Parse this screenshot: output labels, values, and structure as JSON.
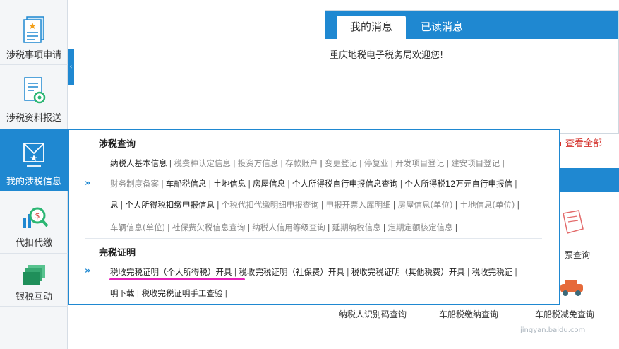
{
  "sidebar": {
    "items": [
      {
        "label": "涉税事项申请",
        "icon": "documents-icon"
      },
      {
        "label": "涉税资料报送",
        "icon": "document-gear-icon"
      },
      {
        "label": "我的涉税信息",
        "icon": "envelope-icon",
        "active": true
      },
      {
        "label": "代扣代缴",
        "icon": "chart-magnifier-icon"
      },
      {
        "label": "银税互动",
        "icon": "stacked-windows-icon"
      }
    ],
    "collapse_glyph": "‹"
  },
  "messages": {
    "tabs": [
      {
        "label": "我的消息",
        "active": true
      },
      {
        "label": "已读消息",
        "active": false
      }
    ],
    "welcome_text": "重庆地税电子税务局欢迎您!",
    "view_all_label": "查看全部"
  },
  "services": {
    "labels": [
      "纳税人识别码查询",
      "车船税缴纳查询",
      "车船税减免查询",
      "票查询"
    ]
  },
  "dropdown": {
    "arrow_glyph": "»",
    "sections": [
      {
        "title": "涉税查询",
        "lines": [
          [
            {
              "text": "纳税人基本信息",
              "style": "dark"
            },
            {
              "text": "税费种认定信息",
              "style": "gray"
            },
            {
              "text": "投资方信息",
              "style": "gray"
            },
            {
              "text": "存款账户",
              "style": "gray"
            },
            {
              "text": "变更登记",
              "style": "gray"
            },
            {
              "text": "停复业",
              "style": "gray"
            },
            {
              "text": "开发项目登记",
              "style": "gray"
            },
            {
              "text": "建安项目登记",
              "style": "gray"
            }
          ],
          [
            {
              "text": "财务制度备案",
              "style": "gray"
            },
            {
              "text": "车船税信息",
              "style": "dark"
            },
            {
              "text": "土地信息",
              "style": "dark"
            },
            {
              "text": "房屋信息",
              "style": "dark"
            },
            {
              "text": "个人所得税自行申报信息查询",
              "style": "dark"
            },
            {
              "text": "个人所得税12万元自行申报信",
              "style": "dark"
            }
          ],
          [
            {
              "text": "息",
              "style": "dark"
            },
            {
              "text": "个人所得税扣缴申报信息",
              "style": "dark"
            },
            {
              "text": "个税代扣代缴明细申报查询",
              "style": "gray"
            },
            {
              "text": "申报开票入库明细",
              "style": "gray"
            },
            {
              "text": "房屋信息(单位)",
              "style": "gray"
            },
            {
              "text": "土地信息(单位)",
              "style": "gray"
            }
          ],
          [
            {
              "text": "车辆信息(单位)",
              "style": "gray"
            },
            {
              "text": "社保费欠税信息查询",
              "style": "gray"
            },
            {
              "text": "纳税人信用等级查询",
              "style": "gray"
            },
            {
              "text": "延期纳税信息",
              "style": "gray"
            },
            {
              "text": "定期定额核定信息",
              "style": "gray"
            }
          ]
        ]
      },
      {
        "title": "完税证明",
        "lines": [
          [
            {
              "text": "税收完税证明（个人所得税）开具",
              "style": "dark"
            },
            {
              "text": "税收完税证明（社保费）开具",
              "style": "dark"
            },
            {
              "text": "税收完税证明（其他税费）开具",
              "style": "dark"
            },
            {
              "text": "税收完税证",
              "style": "dark"
            }
          ],
          [
            {
              "text": "明下载",
              "style": "dark"
            },
            {
              "text": "税收完税证明手工查验",
              "style": "dark"
            }
          ]
        ]
      }
    ]
  },
  "watermark": "jingyan.baidu.com",
  "colors": {
    "accent": "#1f88d1",
    "highlight": "#e620b8",
    "alert": "#d4322c"
  }
}
